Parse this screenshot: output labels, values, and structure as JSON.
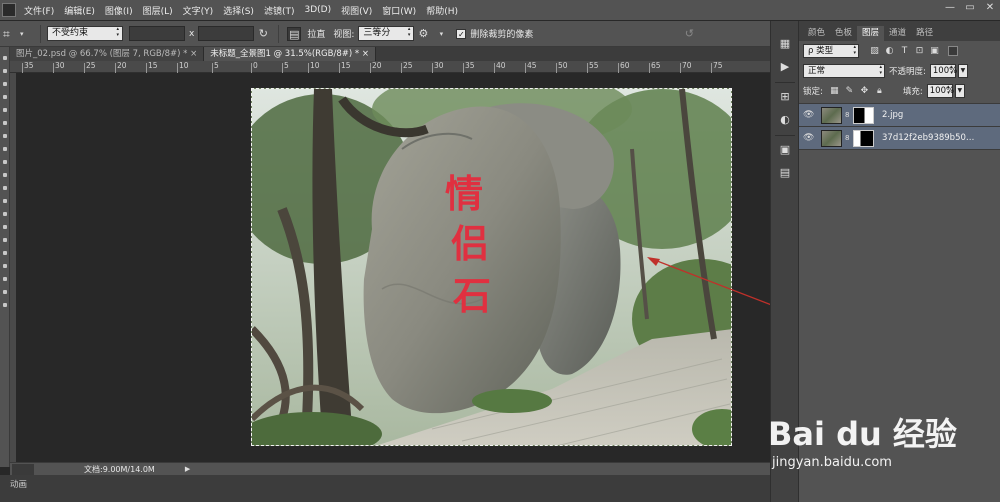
{
  "menubar": {
    "items": [
      "文件(F)",
      "编辑(E)",
      "图像(I)",
      "图层(L)",
      "文字(Y)",
      "选择(S)",
      "滤镜(T)",
      "3D(D)",
      "视图(V)",
      "窗口(W)",
      "帮助(H)"
    ],
    "window_buttons": [
      "—",
      "▭",
      "✕"
    ]
  },
  "options": {
    "ratio_select": "不受约束",
    "x_label": "x",
    "straighten_label": "拉直",
    "view_label": "视图:",
    "view_select": "三等分",
    "delete_cropped_label": "删除裁剪的像素"
  },
  "tabs": [
    {
      "label": "图片_02.psd @ 66.7% (图层 7, RGB/8#) *  ×"
    },
    {
      "label": "未标题_全景图1 @ 31.5%(RGB/8#) *  ×"
    }
  ],
  "ruler": {
    "ticks": [
      "35",
      "30",
      "25",
      "20",
      "15",
      "10",
      "5",
      "0",
      "5",
      "10",
      "15",
      "20",
      "25",
      "30",
      "35",
      "40",
      "45",
      "50",
      "55",
      "60",
      "65",
      "70",
      "75"
    ]
  },
  "statusbar": {
    "doc_info": "文档:9.00M/14.0M",
    "arrow": "▶"
  },
  "bottom": {
    "label": "动画"
  },
  "layers_panel": {
    "tabs": [
      "颜色",
      "色板",
      "图层",
      "通道",
      "路径"
    ],
    "active_tab": "图层",
    "filter_select": "ρ 类型",
    "blend_select": "正常",
    "opacity_label": "不透明度:",
    "opacity_value": "100%",
    "lock_label": "锁定:",
    "fill_label": "填充:",
    "fill_value": "100%",
    "layers": [
      {
        "name": "2.jpg"
      },
      {
        "name": "37d12f2eb9389b50ae..."
      }
    ]
  },
  "image": {
    "inscription": [
      "情",
      "侣",
      "石"
    ]
  },
  "watermark": {
    "logo_text": "Bai du 经验",
    "url": "jingyan.baidu.com"
  },
  "colors": {
    "accent_arrow": "#c0302a",
    "inscription_red": "#e03040"
  }
}
